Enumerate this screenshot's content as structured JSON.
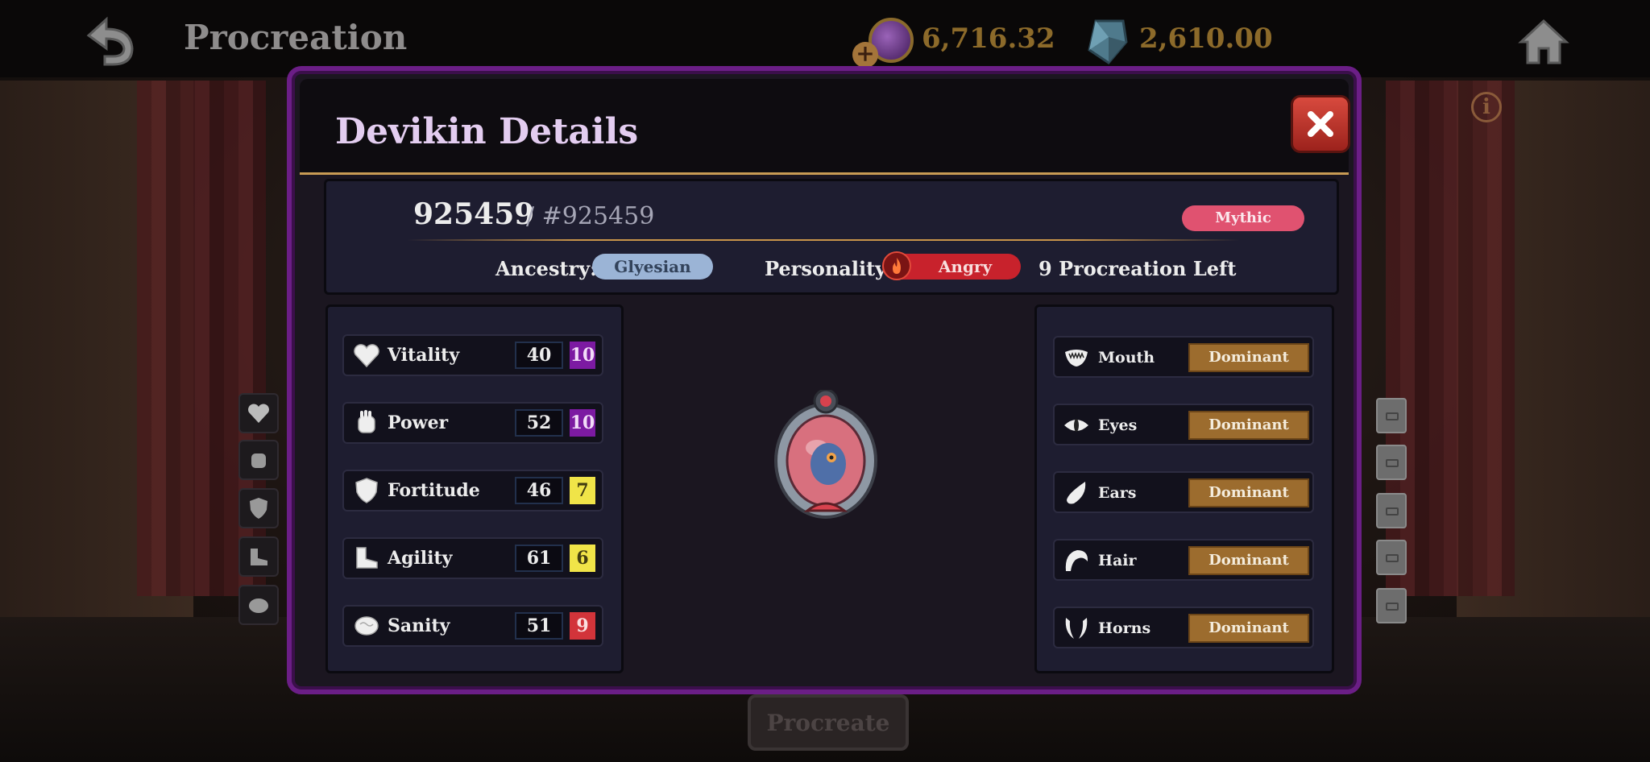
{
  "topbar": {
    "title": "Procreation",
    "coins": "6,716.32",
    "gems": "2,610.00",
    "back_icon": "back-arrow-icon",
    "home_icon": "home-icon",
    "coin_icon": "devikin-coin-icon",
    "gem_icon": "gem-icon"
  },
  "background": {
    "procreate_label": "Procreate",
    "info_icon": "i"
  },
  "modal": {
    "title": "Devikin Details",
    "close_icon": "close-icon"
  },
  "devikin": {
    "id": "925459",
    "sub_id": "/ #925459",
    "rarity": "Mythic",
    "ancestry_label": "Ancestry:",
    "ancestry": "Glyesian",
    "personality_label": "Personality:",
    "personality": "Angry",
    "procreation_left": "9 Procreation Left"
  },
  "stats": [
    {
      "name": "Vitality",
      "value": "40",
      "bonus": "10",
      "icon": "heart-icon"
    },
    {
      "name": "Power",
      "value": "52",
      "bonus": "10",
      "icon": "fist-icon"
    },
    {
      "name": "Fortitude",
      "value": "46",
      "bonus": "7",
      "icon": "shield-icon"
    },
    {
      "name": "Agility",
      "value": "61",
      "bonus": "6",
      "icon": "boot-icon"
    },
    {
      "name": "Sanity",
      "value": "51",
      "bonus": "9",
      "icon": "brain-icon"
    }
  ],
  "traits": [
    {
      "name": "Mouth",
      "value": "Dominant",
      "icon": "mouth-icon"
    },
    {
      "name": "Eyes",
      "value": "Dominant",
      "icon": "eye-icon"
    },
    {
      "name": "Ears",
      "value": "Dominant",
      "icon": "ear-icon"
    },
    {
      "name": "Hair",
      "value": "Dominant",
      "icon": "hair-icon"
    },
    {
      "name": "Horns",
      "value": "Dominant",
      "icon": "horns-icon"
    }
  ],
  "colors": {
    "modal_border": "#6b1e86",
    "rarity_mythic": "#e05270",
    "ancestry_pill": "#9bb4d6",
    "personality_pill": "#c8222c",
    "trait_dominant": "#9c6c2e"
  }
}
